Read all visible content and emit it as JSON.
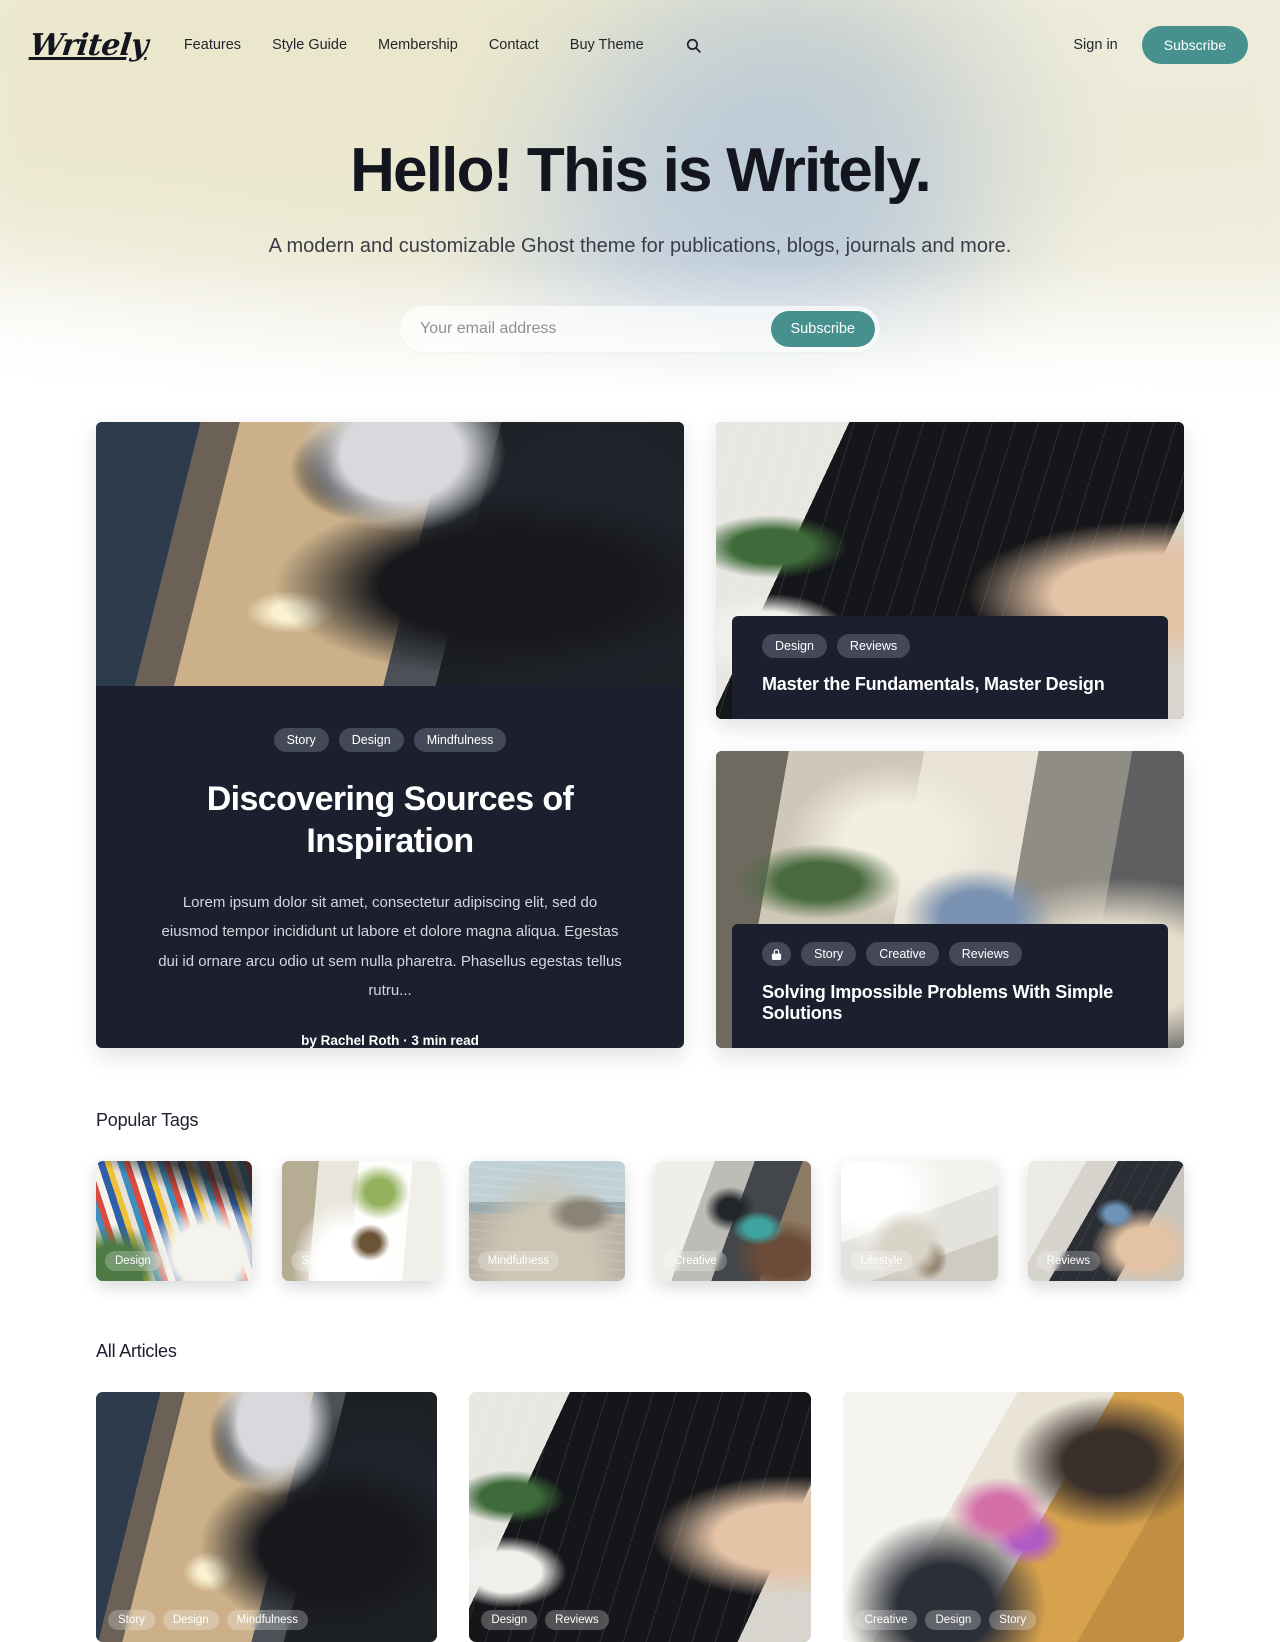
{
  "brand": {
    "logo": "Writely"
  },
  "header": {
    "nav": [
      {
        "label": "Features"
      },
      {
        "label": "Style Guide"
      },
      {
        "label": "Membership"
      },
      {
        "label": "Contact"
      },
      {
        "label": "Buy Theme"
      }
    ],
    "search_icon": "search-icon",
    "signin_label": "Sign in",
    "subscribe_label": "Subscribe"
  },
  "hero": {
    "title": "Hello! This is Writely.",
    "subtitle": "A modern and customizable Ghost theme for publications, blogs, journals and more.",
    "email_placeholder": "Your email address",
    "email_value": "",
    "subscribe_label": "Subscribe"
  },
  "featured": {
    "main": {
      "tags": [
        "Story",
        "Design",
        "Mindfulness"
      ],
      "title": "Discovering Sources of Inspiration",
      "excerpt": "Lorem ipsum dolor sit amet, consectetur adipiscing elit, sed do eiusmod tempor incididunt ut labore et dolore magna aliqua. Egestas dui id ornare arcu odio ut sem nulla pharetra. Phasellus egestas tellus rutru...",
      "meta": "by Rachel Roth · 3 min read"
    },
    "side": [
      {
        "tags": [
          "Design",
          "Reviews"
        ],
        "title": "Master the Fundamentals, Master Design",
        "locked": false
      },
      {
        "tags": [
          "Story",
          "Creative",
          "Reviews"
        ],
        "title": "Solving Impossible Problems With Simple Solutions",
        "locked": true,
        "lock_icon": "lock-icon"
      }
    ]
  },
  "popular_tags": {
    "heading": "Popular Tags",
    "items": [
      {
        "label": "Design"
      },
      {
        "label": "Story"
      },
      {
        "label": "Mindfulness"
      },
      {
        "label": "Creative"
      },
      {
        "label": "Lifestyle"
      },
      {
        "label": "Reviews"
      }
    ]
  },
  "all_articles": {
    "heading": "All Articles",
    "items": [
      {
        "tags": [
          "Story",
          "Design",
          "Mindfulness"
        ]
      },
      {
        "tags": [
          "Design",
          "Reviews"
        ]
      },
      {
        "tags": [
          "Creative",
          "Design",
          "Story"
        ]
      }
    ]
  },
  "colors": {
    "accent": "#46918e",
    "dark_card": "#1b1f2e",
    "pill": "#434958",
    "text": "#1b1f2e",
    "page_bg": "#ffffff"
  }
}
